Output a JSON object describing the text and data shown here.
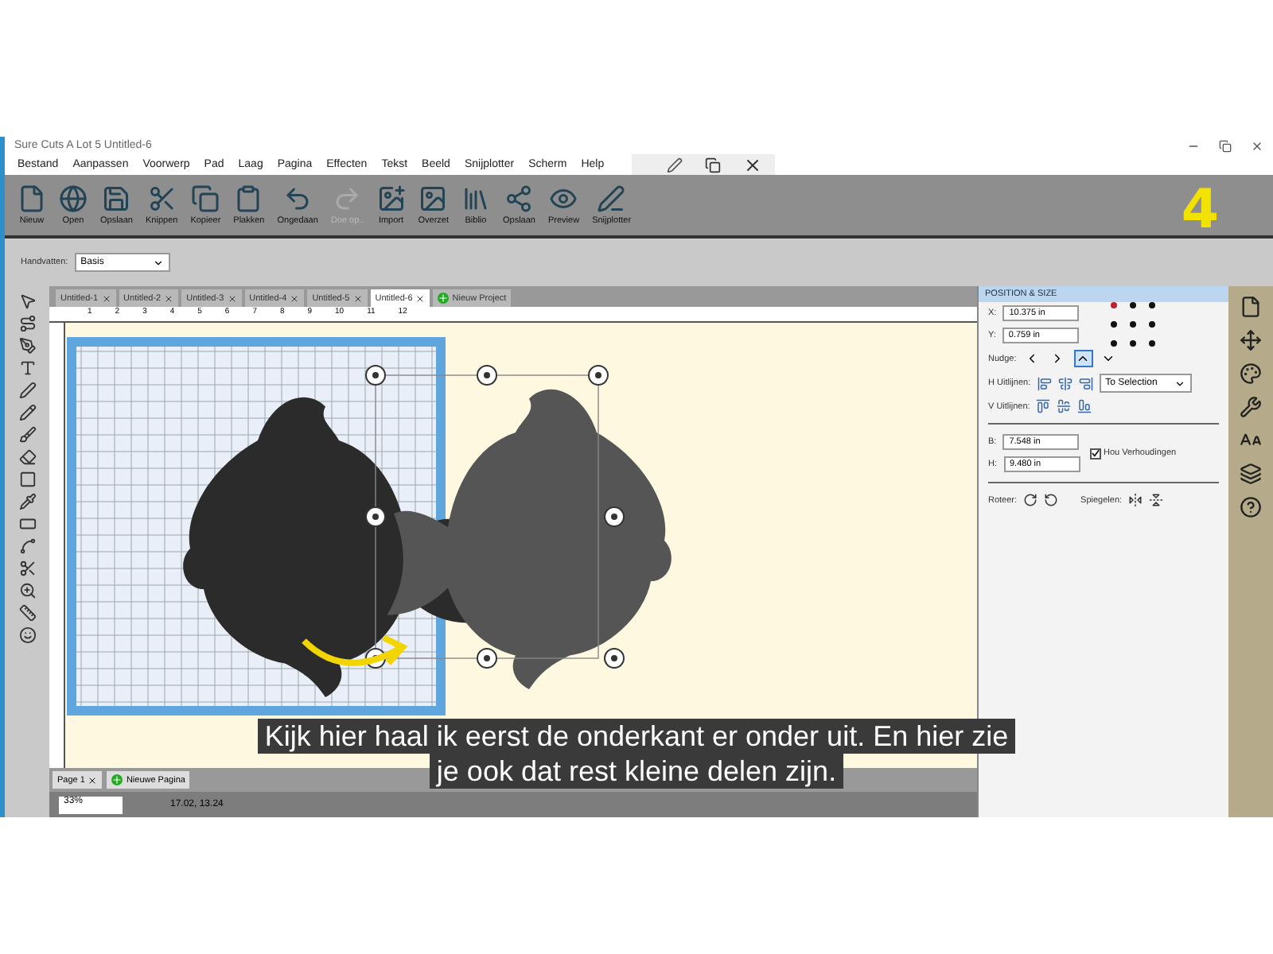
{
  "window": {
    "title": "Sure Cuts A Lot 5 Untitled-6"
  },
  "menu": [
    "Bestand",
    "Aanpassen",
    "Voorwerp",
    "Pad",
    "Laag",
    "Pagina",
    "Effecten",
    "Tekst",
    "Beeld",
    "Snijplotter",
    "Scherm",
    "Help"
  ],
  "toolbar": [
    {
      "label": "Nieuw",
      "disabled": false
    },
    {
      "label": "Open",
      "disabled": false
    },
    {
      "label": "Opslaan",
      "disabled": false
    },
    {
      "label": "Knippen",
      "disabled": false
    },
    {
      "label": "Kopieer",
      "disabled": false
    },
    {
      "label": "Plakken",
      "disabled": false
    },
    {
      "label": "Ongedaan",
      "disabled": false
    },
    {
      "label": "Doe op..",
      "disabled": true
    },
    {
      "label": "Import",
      "disabled": false
    },
    {
      "label": "Overzet",
      "disabled": false
    },
    {
      "label": "Biblio",
      "disabled": false
    },
    {
      "label": "Opslaan",
      "disabled": false
    },
    {
      "label": "Preview",
      "disabled": false
    },
    {
      "label": "Snijplotter",
      "disabled": false
    }
  ],
  "annotation": "4",
  "handles": {
    "label": "Handvatten:",
    "value": "Basis"
  },
  "doc_tabs": [
    {
      "label": "Untitled-1",
      "selected": false
    },
    {
      "label": "Untitled-2",
      "selected": false
    },
    {
      "label": "Untitled-3",
      "selected": false
    },
    {
      "label": "Untitled-4",
      "selected": false
    },
    {
      "label": "Untitled-5",
      "selected": false
    },
    {
      "label": "Untitled-6",
      "selected": true
    }
  ],
  "new_project": "Nieuw Project",
  "ruler": [
    "1",
    "2",
    "3",
    "4",
    "5",
    "6",
    "7",
    "8",
    "9",
    "10",
    "11",
    "12"
  ],
  "panel": {
    "title": "POSITION & SIZE",
    "x_label": "X:",
    "x_value": "10.375 in",
    "y_label": "Y:",
    "y_value": "0.759 in",
    "anchors": [
      {
        "selected": true
      },
      {
        "selected": false
      },
      {
        "selected": false
      },
      {
        "selected": false
      },
      {
        "selected": false
      },
      {
        "selected": false
      },
      {
        "selected": false
      },
      {
        "selected": false
      },
      {
        "selected": false
      }
    ],
    "nudge_label": "Nudge:",
    "nudge": [
      {
        "selected": false
      },
      {
        "selected": false
      },
      {
        "selected": true
      },
      {
        "selected": false
      }
    ],
    "h_align": "H Uitlijnen:",
    "v_align": "V Uitlijnen:",
    "align_to": "To Selection",
    "w_label": "B:",
    "w_value": "7.548 in",
    "h_label": "H:",
    "h_value": "9.480 in",
    "keep_ratio": {
      "label": "Hou Verhoudingen",
      "checked": true
    },
    "rotate": "Roteer:",
    "mirror": "Spiegelen:"
  },
  "page_tab": "Page 1",
  "new_page": "Nieuwe Pagina",
  "status": {
    "zoom": "33%",
    "coords": "17.02, 13.24"
  },
  "subtitles": [
    "Kijk hier haal ik eerst de onderkant er onder uit. En hier zie",
    "je ook dat rest kleine delen zijn."
  ]
}
